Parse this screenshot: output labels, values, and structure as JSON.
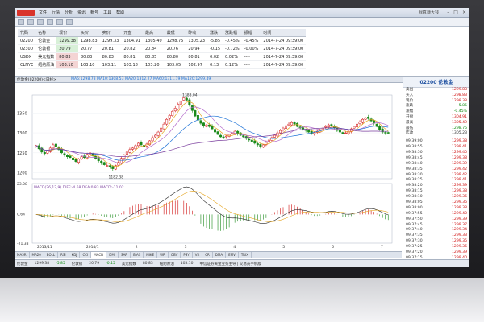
{
  "titlebar": {
    "menu": [
      "文件",
      "行情",
      "分析",
      "资讯",
      "帐号",
      "工具",
      "帮助"
    ],
    "hint": "我真赚大钱"
  },
  "quotes": {
    "headers": [
      "代码",
      "名称",
      "现价",
      "买价",
      "卖价",
      "开盘",
      "最高",
      "最低",
      "昨收",
      "涨跌",
      "涨跌幅",
      "振幅",
      "时间"
    ],
    "rows": [
      {
        "code": "02200",
        "name": "伦敦金",
        "price": "1299.38",
        "bid": "1298.83",
        "ask": "1299.33",
        "open": "1304.91",
        "high": "1305.49",
        "low": "1298.75",
        "prev": "1305.23",
        "chg": "-5.85",
        "pct": "-0.45%",
        "amp": "-0.45%",
        "time": "2014-7-24 09:39:00"
      },
      {
        "code": "02300",
        "name": "伦敦银",
        "price": "20.79",
        "bid": "20.77",
        "ask": "20.81",
        "open": "20.82",
        "high": "20.84",
        "low": "20.76",
        "prev": "20.94",
        "chg": "-0.15",
        "pct": "-0.72%",
        "amp": "-0.00%",
        "time": "2014-7-24 09:39:00"
      },
      {
        "code": "USDX",
        "name": "美元指数",
        "price": "80.83",
        "bid": "80.83",
        "ask": "80.83",
        "open": "80.81",
        "high": "80.85",
        "low": "80.80",
        "prev": "80.81",
        "chg": "0.02",
        "pct": "0.02%",
        "amp": "----",
        "time": "2014-7-24 09:39:00"
      },
      {
        "code": "CLNYE",
        "name": "纽约原油",
        "price": "103.10",
        "bid": "103.10",
        "ask": "103.11",
        "open": "103.18",
        "high": "103.20",
        "low": "103.05",
        "prev": "102.97",
        "chg": "0.13",
        "pct": "0.12%",
        "amp": "----",
        "time": "2014-7-24 09:39:00"
      }
    ]
  },
  "chart_header": {
    "symbol": "伦敦金(02200)<日线>",
    "ma": "MA5:1298.78  MA10:1308.53  MA20:1312.27  MA60:1311.19  MA120:1299.49"
  },
  "chart_data": {
    "type": "candlestick",
    "title": "伦敦金(02200)<日线>",
    "y_axis_labels": [
      "1350",
      "1300",
      "1250",
      "1200"
    ],
    "ylim": [
      1185,
      1395
    ],
    "annotations": {
      "high": "1388.04",
      "low": "1182.38"
    },
    "x_tick_labels": [
      "2013/11",
      "2014/1",
      "2",
      "3",
      "4",
      "5",
      "6",
      "7"
    ],
    "close": [
      1268,
      1260,
      1252,
      1248,
      1255,
      1262,
      1270,
      1266,
      1258,
      1250,
      1244,
      1240,
      1238,
      1232,
      1228,
      1234,
      1240,
      1238,
      1246,
      1250,
      1242,
      1236,
      1230,
      1225,
      1220,
      1218,
      1214,
      1210,
      1218,
      1226,
      1236,
      1244,
      1252,
      1258,
      1262,
      1268,
      1274,
      1270,
      1266,
      1272,
      1280,
      1288,
      1294,
      1302,
      1312,
      1322,
      1334,
      1344,
      1354,
      1362,
      1372,
      1380,
      1388,
      1382,
      1370,
      1356,
      1342,
      1332,
      1324,
      1318,
      1320,
      1316,
      1310,
      1302,
      1296,
      1290,
      1288,
      1292,
      1296,
      1300,
      1304,
      1298,
      1294,
      1290,
      1286,
      1282,
      1278,
      1274,
      1270,
      1266,
      1270,
      1276,
      1282,
      1288,
      1294,
      1300,
      1306,
      1312,
      1318,
      1322,
      1326,
      1322,
      1316,
      1312,
      1310,
      1306,
      1302,
      1298,
      1300,
      1304,
      1308,
      1312,
      1316,
      1320,
      1318,
      1312,
      1306,
      1302,
      1298,
      1300,
      1304,
      1310,
      1316,
      1322,
      1328,
      1334,
      1338,
      1336,
      1330,
      1324,
      1316,
      1308,
      1302,
      1300,
      1299
    ],
    "ma_colors": [
      "#e5a520",
      "#b36acb",
      "#1f73d7",
      "#7a3e9d"
    ],
    "macd": {
      "label": "MACD(26,12,9)  DIFF:-4.68  DEA:0.83  MACD:-11.02",
      "y_axis_labels": [
        "23.08",
        "0.64",
        "-21.38"
      ],
      "ylim": [
        -21.38,
        23.08
      ]
    }
  },
  "right_panel": {
    "code": "02200 伦敦金",
    "rows": [
      [
        "卖出",
        "1299.83",
        "up"
      ],
      [
        "买入",
        "1298.83",
        "up"
      ],
      [
        "现价",
        "1298.38",
        "up"
      ],
      [
        "涨跌",
        "-5.85",
        "dn"
      ],
      [
        "涨幅",
        "-0.45%",
        "dn"
      ],
      [
        "开盘",
        "1304.91",
        "up"
      ],
      [
        "最高",
        "1305.49",
        "up"
      ],
      [
        "最低",
        "1298.75",
        "dn"
      ],
      [
        "昨收",
        "1305.23",
        "lbl"
      ]
    ],
    "ticks": [
      [
        "09:39:00",
        "1299.38"
      ],
      [
        "09:38:55",
        "1299.41"
      ],
      [
        "09:38:50",
        "1299.40"
      ],
      [
        "09:38:45",
        "1299.38"
      ],
      [
        "09:38:40",
        "1299.39"
      ],
      [
        "09:38:35",
        "1299.42"
      ],
      [
        "09:38:30",
        "1299.42"
      ],
      [
        "09:38:25",
        "1299.41"
      ],
      [
        "09:38:20",
        "1299.39"
      ],
      [
        "09:38:15",
        "1299.38"
      ],
      [
        "09:38:10",
        "1299.36"
      ],
      [
        "09:38:05",
        "1299.36"
      ],
      [
        "09:38:00",
        "1299.38"
      ],
      [
        "09:37:55",
        "1299.40"
      ],
      [
        "09:37:50",
        "1299.39"
      ],
      [
        "09:37:45",
        "1299.37"
      ],
      [
        "09:37:40",
        "1299.34"
      ],
      [
        "09:37:35",
        "1299.33"
      ],
      [
        "09:37:30",
        "1299.35"
      ],
      [
        "09:37:25",
        "1299.36"
      ],
      [
        "09:37:20",
        "1299.39"
      ],
      [
        "09:37:15",
        "1299.40"
      ],
      [
        "09:37:10",
        "1299.40"
      ],
      [
        "09:37:05",
        "1299.38"
      ],
      [
        "09:37:00",
        "1299.34"
      ],
      [
        "09:36:55",
        "1299.32"
      ],
      [
        "09:36:50",
        "1299.30"
      ],
      [
        "09:36:45",
        "1299.31"
      ],
      [
        "09:36:40",
        "1299.33"
      ]
    ]
  },
  "tabs": [
    "MA5R",
    "MA20",
    "BOLL",
    "RSI",
    "KDJ",
    "CCI",
    "MACD",
    "DMI",
    "SAR",
    "BIAS",
    "MIKE",
    "WR",
    "OBV",
    "PSY",
    "VR",
    "CR",
    "DMA",
    "EMV",
    "TRIX"
  ],
  "active_tab": "MACD",
  "status": [
    "伦敦金",
    "1299.38",
    "-5.85",
    "伦敦银",
    "20.79",
    "-0.15",
    "美元指数",
    "80.83",
    "纽约原油",
    "103.10",
    "中信证券黄金业务主导 | 交易员手机版"
  ]
}
